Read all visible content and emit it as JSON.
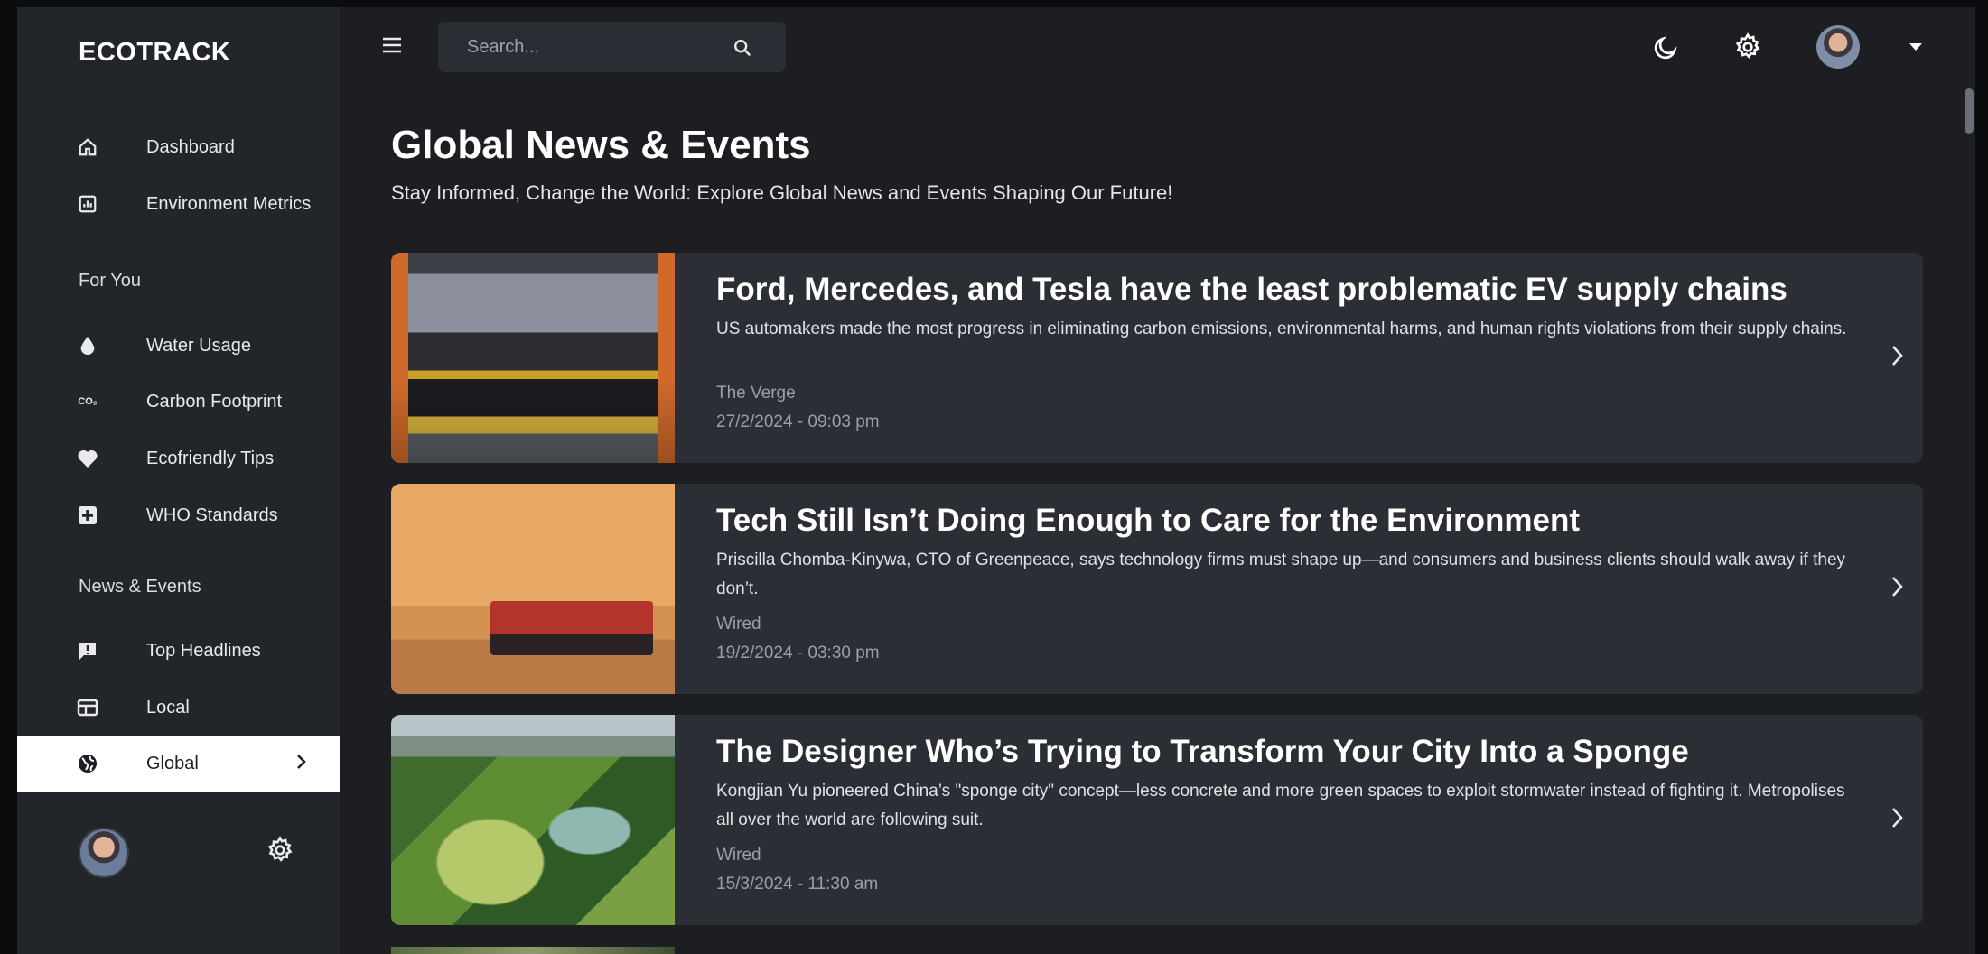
{
  "app": {
    "brand": "ECOTRACK"
  },
  "sidebar": {
    "items": [
      {
        "label": "Dashboard",
        "icon": "home-icon"
      },
      {
        "label": "Environment Metrics",
        "icon": "chart-icon"
      }
    ],
    "section_for_you": "For You",
    "for_you_items": [
      {
        "label": "Water Usage",
        "icon": "water-drop-icon"
      },
      {
        "label": "Carbon Footprint",
        "icon": "co2-icon",
        "icon_text": "CO₂"
      },
      {
        "label": "Ecofriendly Tips",
        "icon": "heart-icon"
      },
      {
        "label": "WHO Standards",
        "icon": "plus-box-icon"
      }
    ],
    "section_news": "News & Events",
    "news_items": [
      {
        "label": "Top Headlines",
        "icon": "alert-message-icon"
      },
      {
        "label": "Local",
        "icon": "newspaper-icon"
      },
      {
        "label": "Global",
        "icon": "globe-icon",
        "active": true
      }
    ]
  },
  "topbar": {
    "search_placeholder": "Search..."
  },
  "page": {
    "title": "Global News & Events",
    "subtitle": "Stay Informed, Change the World: Explore Global News and Events Shaping Our Future!"
  },
  "articles": [
    {
      "title": "Ford, Mercedes, and Tesla have the least problematic EV supply chains",
      "description": "US automakers made the most progress in eliminating carbon emissions, environmental harms, and human rights violations from their supply chains.",
      "source": "The Verge",
      "date": "27/2/2024 - 09:03 pm"
    },
    {
      "title": "Tech Still Isn’t Doing Enough to Care for the Environment",
      "description": "Priscilla Chomba-Kinywa, CTO of Greenpeace, says technology firms must shape up—and consumers and business clients should walk away if they don’t.",
      "source": "Wired",
      "date": "19/2/2024 - 03:30 pm"
    },
    {
      "title": "The Designer Who’s Trying to Transform Your City Into a Sponge",
      "description": "Kongjian Yu pioneered China’s \"sponge city\" concept—less concrete and more green spaces to exploit stormwater instead of fighting it. Metropolises all over the world are following suit.",
      "source": "Wired",
      "date": "15/3/2024 - 11:30 am"
    }
  ],
  "colors": {
    "background": "#1c1e22",
    "sidebar": "#22252a",
    "card": "#2b2e34",
    "active_nav": "#ffffff"
  }
}
